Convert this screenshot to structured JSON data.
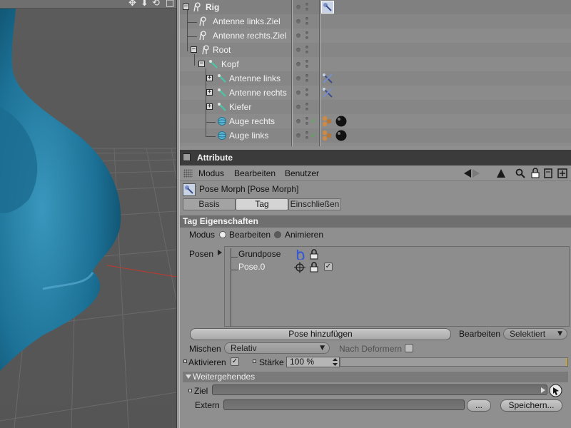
{
  "viewport": {
    "toolbar_icons": [
      "move-view-icon",
      "dolly-icon",
      "rotate-view-icon",
      "maximize-icon"
    ],
    "toolbar_glyphs": [
      "✥",
      "⬇",
      "⟲",
      "□"
    ],
    "model_color": "#1f7597"
  },
  "object_manager": {
    "rows": [
      {
        "label": "Rig",
        "icon": "null-object-icon"
      },
      {
        "label": "Antenne links.Ziel",
        "icon": "null-object-icon"
      },
      {
        "label": "Antenne rechts.Ziel",
        "icon": "null-object-icon"
      },
      {
        "label": "Root",
        "icon": "null-object-icon"
      },
      {
        "label": "Kopf",
        "icon": "joint-icon"
      },
      {
        "label": "Antenne links",
        "icon": "joint-icon"
      },
      {
        "label": "Antenne rechts",
        "icon": "joint-icon"
      },
      {
        "label": "Kiefer",
        "icon": "joint-icon"
      },
      {
        "label": "Auge rechts",
        "icon": "sphere-icon"
      },
      {
        "label": "Auge links",
        "icon": "sphere-icon"
      }
    ],
    "expander_glyph": "+",
    "collapse_glyph": "−",
    "check_glyph": "✓"
  },
  "attributes": {
    "title": "Attribute",
    "menu": {
      "modus": "Modus",
      "bearbeiten": "Bearbeiten",
      "benutzer": "Benutzer"
    },
    "object_name": "Pose Morph [Pose Morph]",
    "tabs": {
      "basis": "Basis",
      "tag": "Tag",
      "einschliessen": "Einschließen"
    },
    "section_title": "Tag Eigenschaften",
    "modus_label": "Modus",
    "modus_options": {
      "bearbeiten": "Bearbeiten",
      "animieren": "Animieren"
    },
    "posen_label": "Posen",
    "posen": [
      {
        "name": "Grundpose"
      },
      {
        "name": "Pose.0"
      }
    ],
    "add_pose_button": "Pose hinzufügen",
    "bearbeiten_label": "Bearbeiten",
    "bearbeiten_value": "Selektiert",
    "mischen_label": "Mischen",
    "mischen_value": "Relativ",
    "nach_deformern_label": "Nach Deformern",
    "aktivieren_label": "Aktivieren",
    "staerke_label": "Stärke",
    "staerke_value": "100 %",
    "staerke_fraction": 1.0,
    "weiter_label": "Weitergehendes",
    "ziel_label": "Ziel",
    "extern_label": "Extern",
    "dots_button": "...",
    "speichern_button": "Speichern..."
  }
}
